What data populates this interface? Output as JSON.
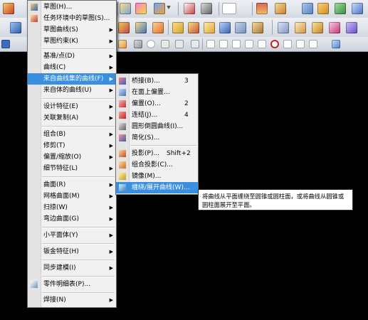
{
  "main_menu": {
    "items": [
      {
        "label": "草图(H)..."
      },
      {
        "label": "任务环境中的草图(S)..."
      },
      {
        "label": "草图曲线(S)"
      },
      {
        "label": "草图约束(K)"
      },
      {
        "label": "基准/点(D)"
      },
      {
        "label": "曲线(C)"
      },
      {
        "label": "来自曲线集的曲线(F)"
      },
      {
        "label": "来自体的曲线(U)"
      },
      {
        "label": "设计特征(E)"
      },
      {
        "label": "关联复制(A)"
      },
      {
        "label": "组合(B)"
      },
      {
        "label": "修剪(T)"
      },
      {
        "label": "偏置/缩放(O)"
      },
      {
        "label": "细节特征(L)"
      },
      {
        "label": "曲面(R)"
      },
      {
        "label": "网格曲面(M)"
      },
      {
        "label": "扫掠(W)"
      },
      {
        "label": "弯边曲面(G)"
      },
      {
        "label": "小平面体(Y)"
      },
      {
        "label": "钣金特征(H)"
      },
      {
        "label": "同步建模(I)"
      },
      {
        "label": "零件明细表(P)..."
      },
      {
        "label": "焊接(N)"
      }
    ]
  },
  "sub_menu": {
    "items": [
      {
        "label": "桥接(B)...",
        "shortcut": "3"
      },
      {
        "label": "在面上偏置...",
        "shortcut": ""
      },
      {
        "label": "偏置(O)...",
        "shortcut": "2"
      },
      {
        "label": "连结(J)...",
        "shortcut": "4"
      },
      {
        "label": "圆形倒圆曲线(I)...",
        "shortcut": ""
      },
      {
        "label": "简化(S)...",
        "shortcut": ""
      },
      {
        "label": "投影(P)...",
        "shortcut": "Shift+2"
      },
      {
        "label": "组合投影(C)...",
        "shortcut": ""
      },
      {
        "label": "镜像(M)...",
        "shortcut": ""
      },
      {
        "label": "缠绕/展开曲线(W)...",
        "shortcut": ""
      }
    ]
  },
  "tooltip": {
    "text": "将曲线从平面缠绕至圆锥或圆柱面，或将曲线从圆锥或圆柱面展开至平面。"
  },
  "colors": {
    "highlight": "#3a8fe0",
    "menu_bg": "#f1f1f1",
    "canvas_bg": "#000000"
  }
}
